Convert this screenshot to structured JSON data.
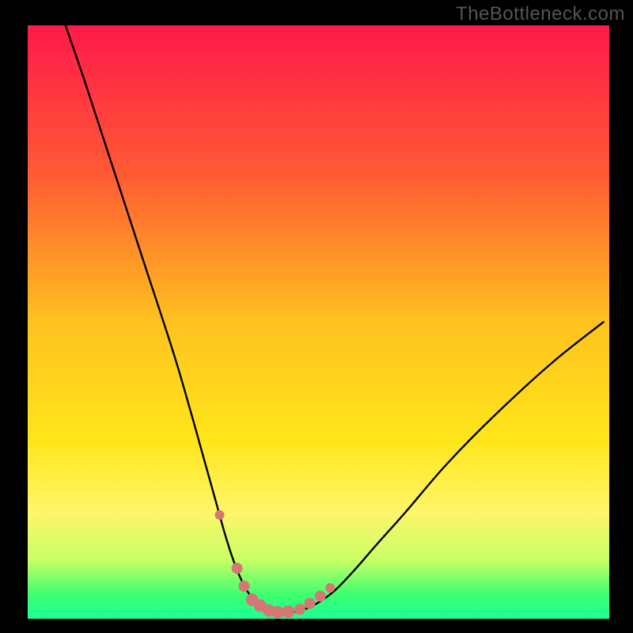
{
  "watermark": "TheBottleneck.com",
  "chart_data": {
    "type": "line",
    "title": "",
    "xlabel": "",
    "ylabel": "",
    "xlim": [
      0,
      100
    ],
    "ylim": [
      0,
      100
    ],
    "background_gradient_stops": [
      {
        "offset": 0.0,
        "color": "#ff1a4b"
      },
      {
        "offset": 0.25,
        "color": "#ff5a33"
      },
      {
        "offset": 0.5,
        "color": "#ffc21f"
      },
      {
        "offset": 0.7,
        "color": "#ffe61a"
      },
      {
        "offset": 0.82,
        "color": "#fff56a"
      },
      {
        "offset": 0.9,
        "color": "#c9ff66"
      },
      {
        "offset": 0.96,
        "color": "#3cff6e"
      },
      {
        "offset": 1.0,
        "color": "#19ff95"
      }
    ],
    "series": [
      {
        "name": "curve",
        "color": "#000000",
        "x": [
          6.5,
          10,
          15,
          20,
          25,
          28,
          30,
          32,
          34,
          35.5,
          37,
          38.5,
          40,
          41.5,
          43.5,
          46,
          49,
          52.5,
          56,
          60,
          65,
          72,
          80,
          90,
          99
        ],
        "y": [
          100,
          90,
          75,
          60,
          45,
          35,
          28,
          21,
          14,
          9.5,
          6.0,
          3.6,
          2.2,
          1.4,
          1.0,
          1.2,
          2.2,
          4.5,
          8.0,
          12.5,
          18,
          26,
          34,
          43,
          50
        ]
      }
    ],
    "markers": {
      "name": "points",
      "color": "#d77676",
      "x": [
        33.0,
        36.0,
        37.2,
        38.6,
        40.0,
        41.5,
        43.0,
        44.8,
        46.8,
        48.5,
        50.3,
        52.0
      ],
      "y": [
        17.5,
        8.5,
        5.5,
        3.2,
        2.2,
        1.4,
        1.1,
        1.2,
        1.6,
        2.6,
        3.8,
        5.2
      ],
      "r": [
        6,
        7,
        7,
        8,
        8,
        8,
        8,
        8,
        7,
        7,
        7,
        6
      ]
    }
  }
}
